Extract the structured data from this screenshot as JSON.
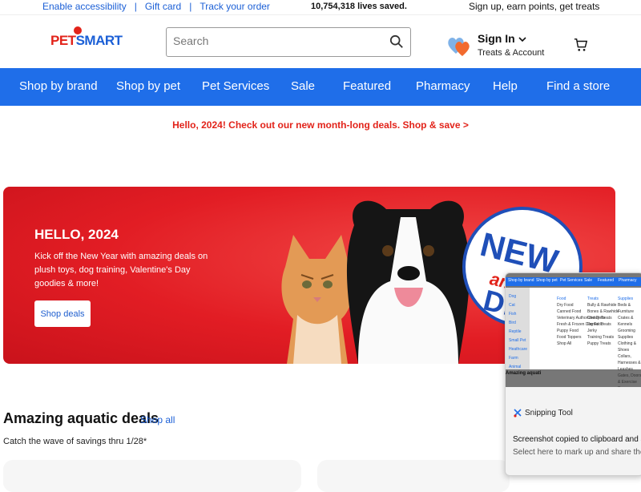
{
  "utility": {
    "links": [
      "Enable accessibility",
      "Gift card",
      "Track your order"
    ],
    "lives_saved": "10,754,318 lives saved.",
    "treats_promo": "Sign up, earn points, get treats"
  },
  "header": {
    "logo_pet": "PET",
    "logo_smart": "SMART",
    "search_placeholder": "Search",
    "sign_in": "Sign In",
    "treats_account": "Treats & Account"
  },
  "nav": {
    "items": [
      "Shop by brand",
      "Shop by pet",
      "Pet Services",
      "Sale",
      "Featured",
      "Pharmacy",
      "Help",
      "Find a store"
    ]
  },
  "promo": {
    "text": "Hello, 2024! Check out our new month-long deals. Shop & save >"
  },
  "hero": {
    "title": "HELLO, 2024",
    "body": "Kick off the New Year with amazing deals on plush toys, dog training, Valentine's Day goodies & more!",
    "button": "Shop deals",
    "badge_new": "NEW",
    "badge_amazing": "ama",
    "badge_deals": "DEA"
  },
  "section": {
    "title": "Amazing aquatic deals",
    "shop_all": "Shop all",
    "subtitle": "Catch the wave of savings thru 1/28*"
  },
  "snip": {
    "thumb_nav": [
      "Shop by brand",
      "Shop by pet",
      "Pet Services",
      "Sale",
      "Featured",
      "Pharmacy"
    ],
    "thumb_left": [
      "Dog",
      "Cat",
      "Fish",
      "Bird",
      "Reptile",
      "Small Pet",
      "Heathcare",
      "Farm Animal"
    ],
    "thumb_cols": [
      {
        "head": "Food",
        "items": [
          "Dry Food",
          "Canned Food",
          "Veterinary Authorized Diets",
          "Fresh & Frozen Dog Food",
          "Puppy Food",
          "Food Toppers",
          "Shop All"
        ]
      },
      {
        "head": "Treats",
        "items": [
          "Bully & Rawhide",
          "Bones & Rawhide",
          "Chewy Treats",
          "Dental Treats",
          "Jerky",
          "Training Treats",
          "Puppy Treats"
        ]
      },
      {
        "head": "Supplies",
        "items": [
          "Beds & Furniture",
          "Crates & Kennels",
          "Grooming Supplies",
          "Clothing & Shoes",
          "Collars, Harnesses & Leashes",
          "Gates, Doors & Exercise Pens"
        ]
      }
    ],
    "thumb_aquatic": "Amazing aquati",
    "app_name": "Snipping Tool",
    "message": "Screenshot copied to clipboard and saved",
    "hint": "Select here to mark up and share the image"
  }
}
